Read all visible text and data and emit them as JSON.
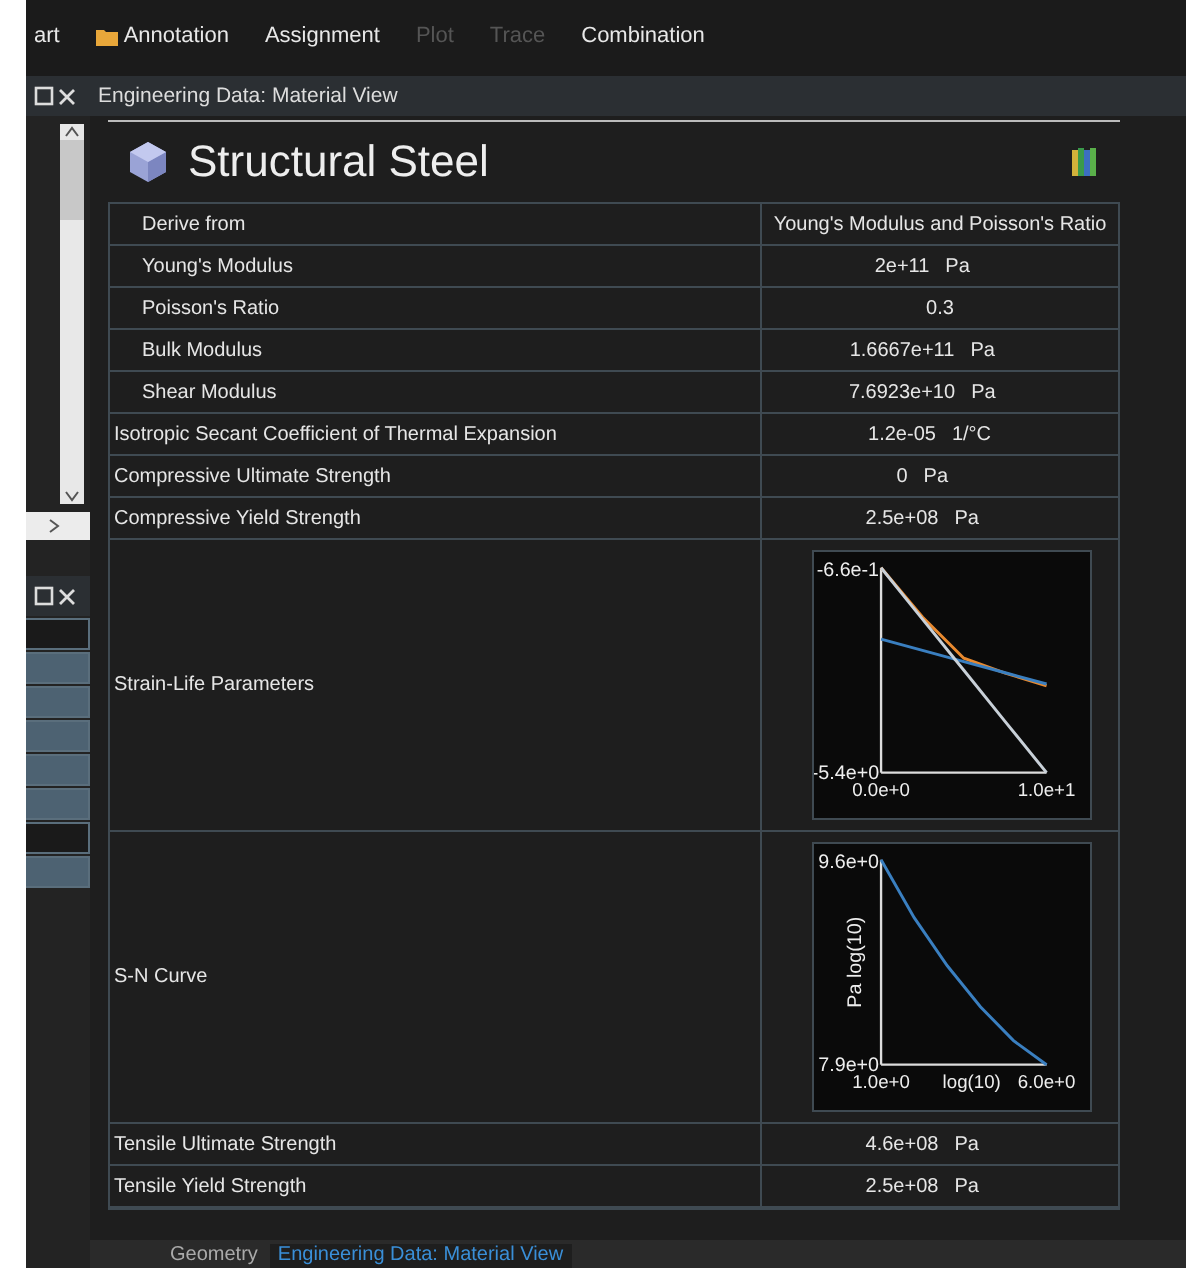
{
  "toolbar": {
    "items": [
      {
        "label": "art",
        "disabled": false
      },
      {
        "label": "Annotation",
        "disabled": false,
        "kind": "folder"
      },
      {
        "label": "Assignment",
        "disabled": false
      },
      {
        "label": "Plot",
        "disabled": true
      },
      {
        "label": "Trace",
        "disabled": true
      },
      {
        "label": "Combination",
        "disabled": false
      }
    ]
  },
  "document": {
    "title": "Engineering Data: Material View"
  },
  "material": {
    "name": "Structural Steel"
  },
  "table": {
    "rows": [
      {
        "kind": "group",
        "children": [
          {
            "kind": "property",
            "label": "Derive from",
            "value": "Young's Modulus and Poisson's Ratio"
          },
          {
            "kind": "property",
            "label": "Young's Modulus",
            "value": "2e+11",
            "unit": "Pa"
          },
          {
            "kind": "property",
            "label": "Poisson's Ratio",
            "value": "0.3"
          },
          {
            "kind": "property",
            "label": "Bulk Modulus",
            "value": "1.6667e+11",
            "unit": "Pa"
          },
          {
            "kind": "property",
            "label": "Shear Modulus",
            "value": "7.6923e+10",
            "unit": "Pa"
          }
        ]
      },
      {
        "kind": "property",
        "label": "Isotropic Secant Coefficient of Thermal Expansion",
        "value": "1.2e-05",
        "unit": "1/°C"
      },
      {
        "kind": "property",
        "label": "Compressive Ultimate Strength",
        "value": "0",
        "unit": "Pa"
      },
      {
        "kind": "property",
        "label": "Compressive Yield Strength",
        "value": "2.5e+08",
        "unit": "Pa"
      },
      {
        "kind": "chart",
        "label": "Strain-Life Parameters",
        "chart_data": {
          "type": "line",
          "x": [
            0,
            2.5,
            5,
            7.5,
            10
          ],
          "xlim": [
            0,
            10
          ],
          "ylim": [
            -5.4,
            -0.66
          ],
          "xticks": [
            {
              "value": 0,
              "label": "0.0e+0"
            },
            {
              "value": 10,
              "label": "1.0e+1"
            }
          ],
          "yticks": [
            {
              "value": -0.66,
              "label": "-6.6e-1"
            },
            {
              "value": -5.4,
              "label": "-5.4e+0"
            }
          ],
          "series": [
            {
              "color": "#e8892f",
              "values": [
                -0.66,
                -1.8,
                -2.75,
                -3.1,
                -3.39
              ]
            },
            {
              "color": "#3a7fc0",
              "values": [
                -2.31,
                -2.57,
                -2.83,
                -3.09,
                -3.35
              ]
            },
            {
              "color": "#c8d0d8",
              "values": [
                -0.66,
                -1.85,
                -3.03,
                -4.22,
                -5.4
              ]
            }
          ]
        }
      },
      {
        "kind": "chart",
        "label": "S-N Curve",
        "chart_data": {
          "type": "line",
          "xlabel": "log(10)",
          "ylabel": "Pa log(10)",
          "x": [
            1,
            2,
            3,
            4,
            5,
            6
          ],
          "xlim": [
            1,
            6
          ],
          "ylim": [
            7.9,
            9.6
          ],
          "xticks": [
            {
              "value": 1,
              "label": "1.0e+0"
            },
            {
              "value": 6,
              "label": "6.0e+0"
            }
          ],
          "yticks": [
            {
              "value": 9.6,
              "label": "9.6e+0"
            },
            {
              "value": 7.9,
              "label": "7.9e+0"
            }
          ],
          "series": [
            {
              "color": "#3a7fc0",
              "values": [
                9.6,
                9.12,
                8.72,
                8.38,
                8.1,
                7.9
              ]
            }
          ]
        }
      },
      {
        "kind": "property",
        "label": "Tensile Ultimate Strength",
        "value": "4.6e+08",
        "unit": "Pa"
      },
      {
        "kind": "property",
        "label": "Tensile Yield Strength",
        "value": "2.5e+08",
        "unit": "Pa"
      }
    ]
  },
  "lower_pane": {
    "rows": [
      {
        "highlighted": false
      },
      {
        "highlighted": true
      },
      {
        "highlighted": true
      },
      {
        "highlighted": true
      },
      {
        "highlighted": true
      },
      {
        "highlighted": true
      },
      {
        "highlighted": false
      },
      {
        "highlighted": true
      }
    ]
  },
  "bottom_tabs": [
    {
      "label": "Geometry",
      "selected": false
    },
    {
      "label": "Engineering Data: Material View",
      "selected": true
    }
  ]
}
